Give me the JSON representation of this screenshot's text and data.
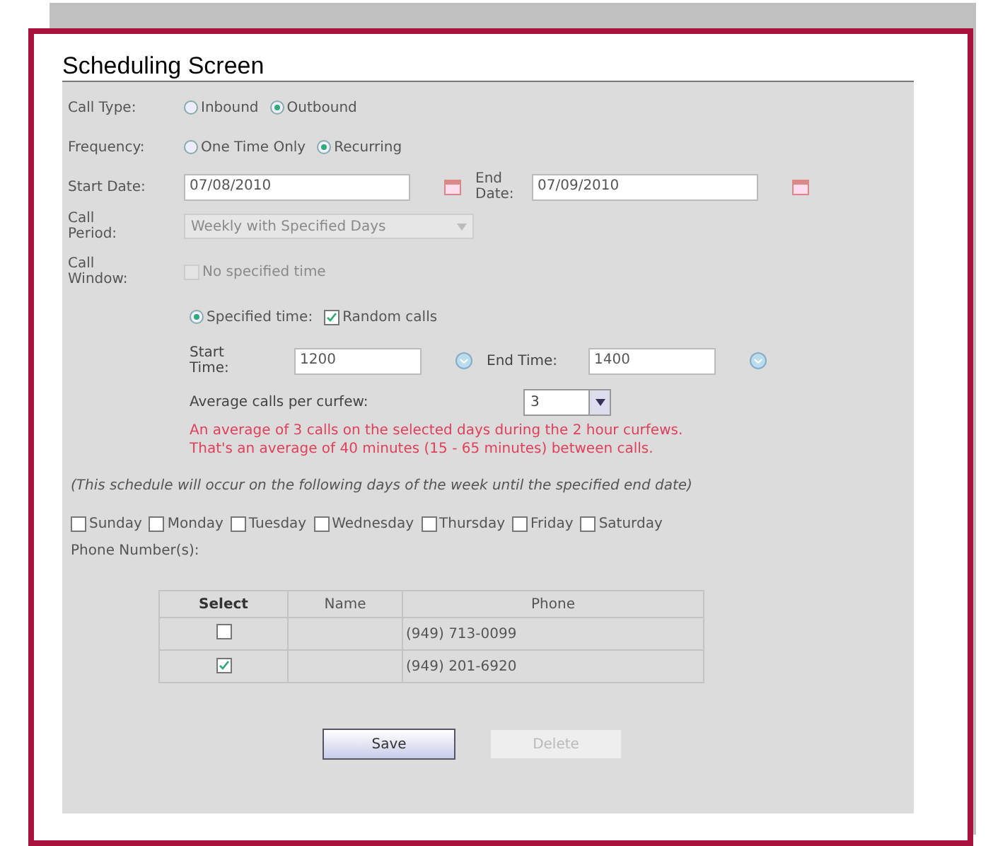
{
  "title": "Scheduling Screen",
  "call_type": {
    "label": "Call Type:",
    "options": [
      {
        "label": "Inbound",
        "selected": false
      },
      {
        "label": "Outbound",
        "selected": true
      }
    ]
  },
  "frequency": {
    "label": "Frequency:",
    "options": [
      {
        "label": "One Time Only",
        "selected": false
      },
      {
        "label": "Recurring",
        "selected": true
      }
    ]
  },
  "start_date": {
    "label": "Start Date:",
    "value": "07/08/2010"
  },
  "end_date": {
    "label": "End Date:",
    "value": "07/09/2010"
  },
  "call_period": {
    "label": "Call Period:",
    "value": "Weekly with Specified Days",
    "disabled": true
  },
  "call_window": {
    "label": "Call Window:",
    "no_specified_time": {
      "label": "No specified time",
      "checked": false,
      "disabled": true
    },
    "specified_time": {
      "label": "Specified time:",
      "selected": true
    },
    "random_calls": {
      "label": "Random calls",
      "checked": true
    },
    "start_time": {
      "label": "Start Time:",
      "value": "1200"
    },
    "end_time": {
      "label": "End Time:",
      "value": "1400"
    },
    "average": {
      "label": "Average calls per curfew:",
      "value": "3"
    },
    "message": [
      "An average of 3 calls on the selected days during the 2 hour curfews.",
      "That's an average of 40 minutes (15 - 65 minutes) between calls."
    ]
  },
  "note": "(This schedule will occur on the following days of the week until the specified end date)",
  "days": [
    {
      "label": "Sunday",
      "checked": false
    },
    {
      "label": "Monday",
      "checked": false
    },
    {
      "label": "Tuesday",
      "checked": false
    },
    {
      "label": "Wednesday",
      "checked": false
    },
    {
      "label": "Thursday",
      "checked": false
    },
    {
      "label": "Friday",
      "checked": false
    },
    {
      "label": "Saturday",
      "checked": false
    }
  ],
  "phones": {
    "label": "Phone Number(s):",
    "columns": [
      "Select",
      "Name",
      "Phone"
    ],
    "rows": [
      {
        "selected": false,
        "phone": "(949) 713-0099"
      },
      {
        "selected": true,
        "phone": "(949) 201-6920"
      }
    ]
  },
  "buttons": [
    {
      "label": "Save",
      "disabled": false
    },
    {
      "label": "Delete",
      "disabled": true
    }
  ]
}
